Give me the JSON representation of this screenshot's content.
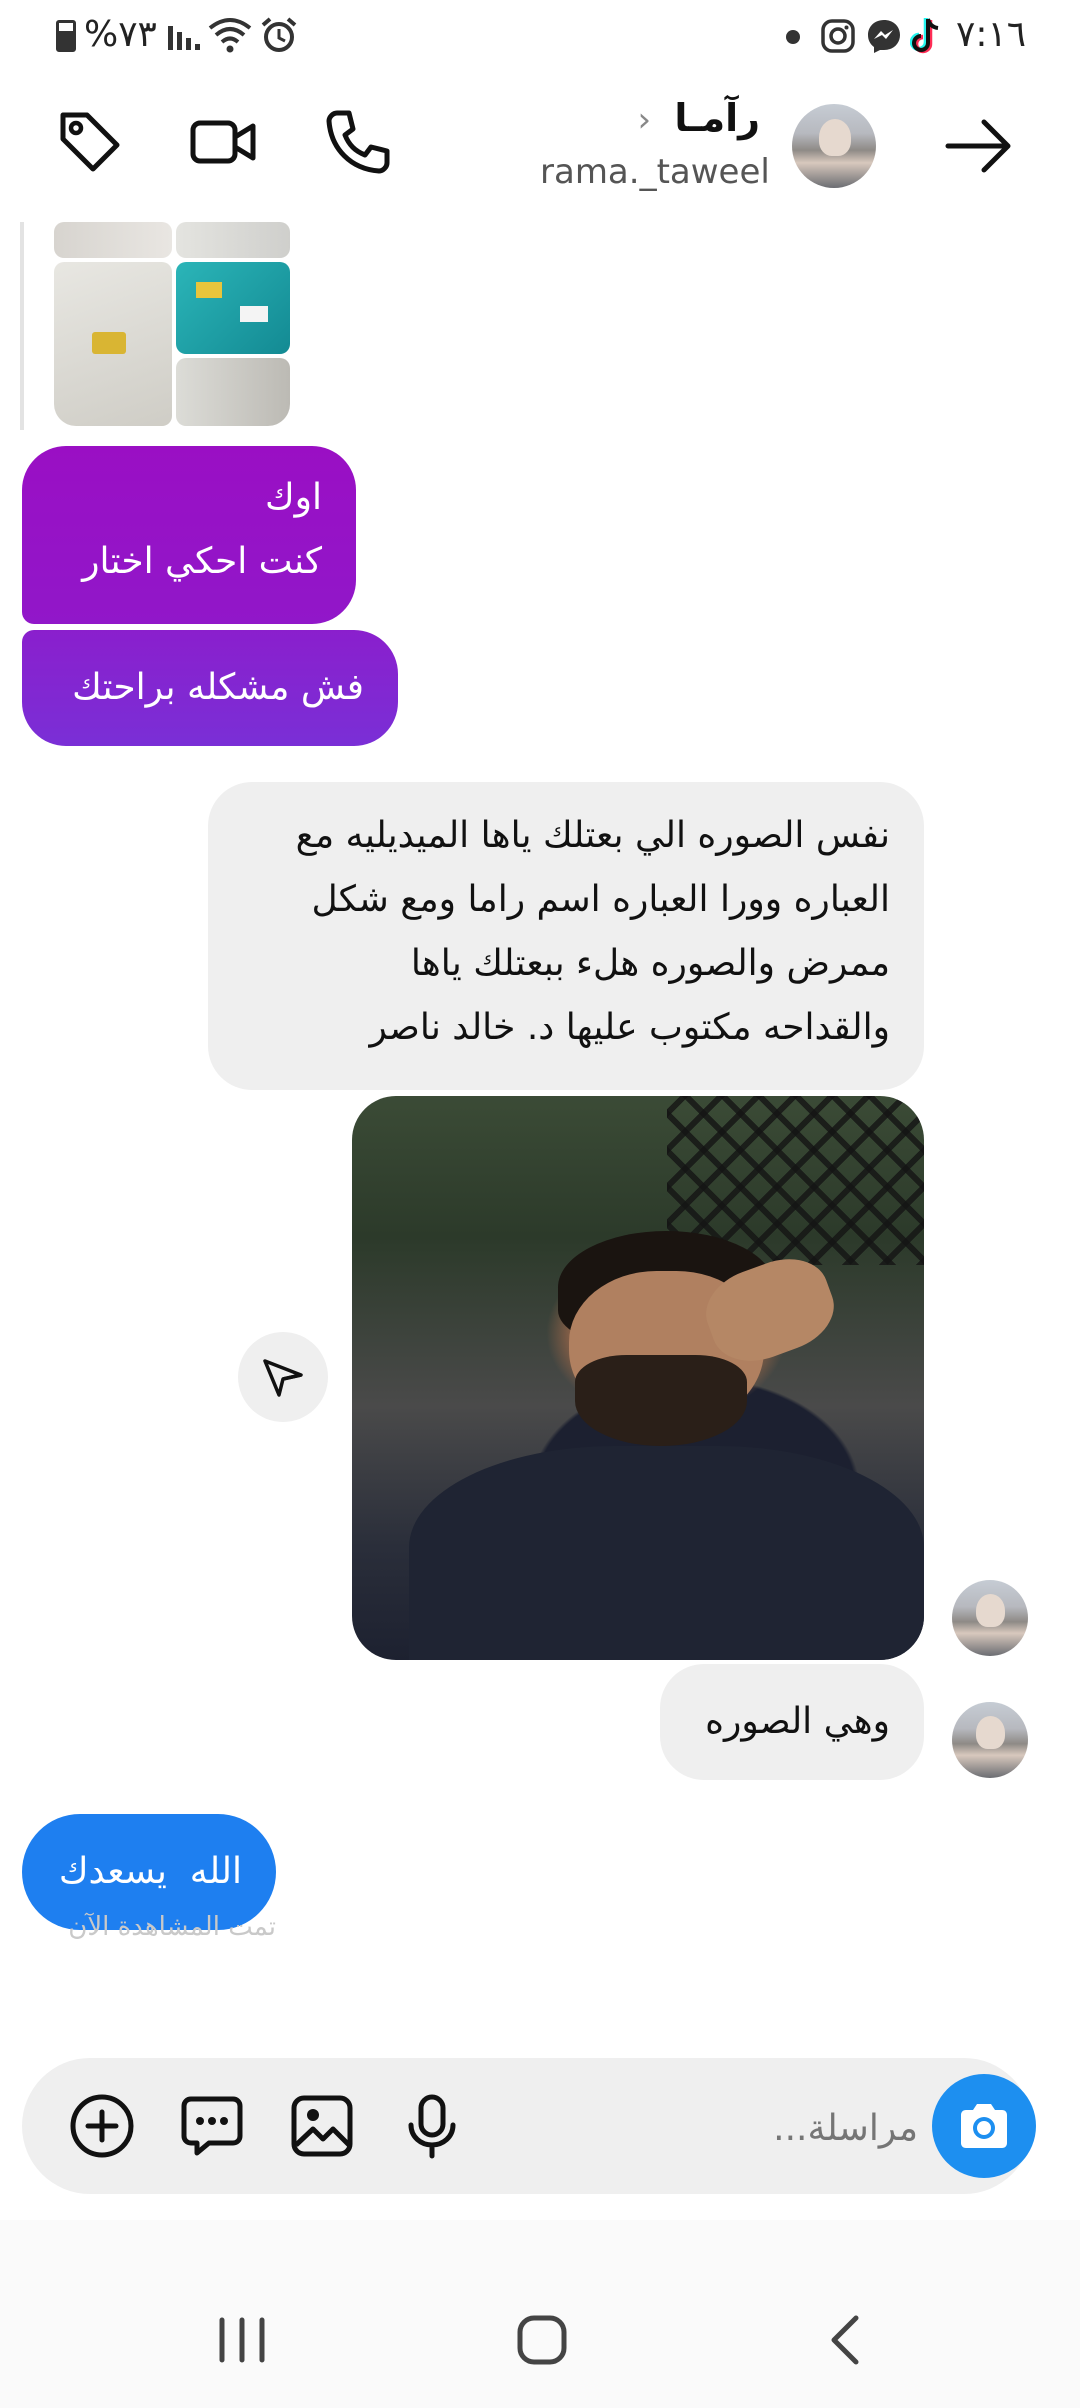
{
  "status_bar": {
    "battery": "%٧٣",
    "time": "٧:١٦",
    "signal": "signal-icon",
    "wifi": "wifi-icon",
    "alarm": "alarm-icon",
    "notifications": [
      "instagram-icon",
      "messenger-icon",
      "tiktok-icon"
    ]
  },
  "header": {
    "name": "رآمـا",
    "username": "rama._taweel",
    "icons": [
      "back-arrow-icon",
      "phone-icon",
      "video-icon",
      "tag-icon"
    ]
  },
  "messages": [
    {
      "id": "m1",
      "from": "me",
      "lines": [
        "اوك",
        "كنت احكي اختار"
      ]
    },
    {
      "id": "m2",
      "from": "me",
      "lines": [
        "فش مشكله براحتك"
      ]
    },
    {
      "id": "m3",
      "from": "them",
      "lines": [
        "نفس الصوره الي بعتلك ياها الميديليه مع",
        "العباره وورا العباره اسم راما ومع شكل",
        "ممرض والصوره هلء ببعتلك ياها",
        "والقداحه مكتوب عليها د. خالد ناصر"
      ]
    },
    {
      "id": "m4",
      "from": "them",
      "type": "photo"
    },
    {
      "id": "m5",
      "from": "them",
      "lines": [
        "وهي الصوره"
      ]
    },
    {
      "id": "m6",
      "from": "me",
      "lines": [
        "الله  يسعدك"
      ]
    }
  ],
  "seen_label": "تمت المشاهدة الآن",
  "composer": {
    "placeholder": "مراسلة...",
    "icons": [
      "camera-icon",
      "mic-icon",
      "gallery-icon",
      "sticker-chat-icon",
      "plus-icon"
    ]
  },
  "colors": {
    "gradient_top": "#9d13c5",
    "gradient_bottom": "#7a2fd6",
    "blue": "#1e7ff0",
    "camera": "#1d8ff0",
    "bubble_grey": "#efefef"
  }
}
